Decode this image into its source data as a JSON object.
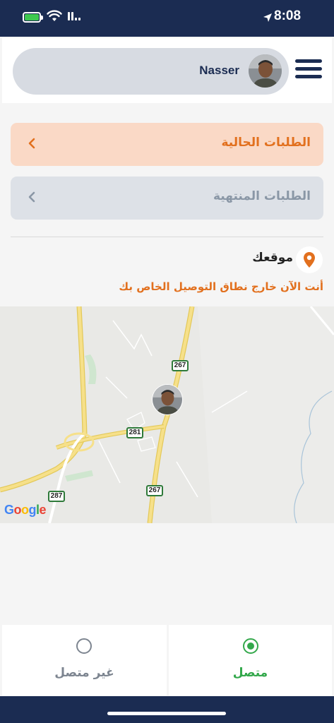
{
  "status_bar": {
    "time": "8:08"
  },
  "header": {
    "user_name": "Nasser"
  },
  "orders": {
    "current_label": "الطلبات الحالية",
    "finished_label": "الطلبات المنتهية"
  },
  "location": {
    "title": "موقعك",
    "warning": "أنت الآن خارج نطاق التوصيل الخاص بك"
  },
  "map": {
    "road_labels": [
      "267",
      "281",
      "267",
      "287"
    ],
    "provider": "Google"
  },
  "status_tabs": {
    "offline_label": "غير متصل",
    "online_label": "متصل",
    "selected": "online"
  },
  "colors": {
    "navy": "#1b2c52",
    "accent_orange": "#e2701e",
    "online_green": "#33a84b"
  }
}
